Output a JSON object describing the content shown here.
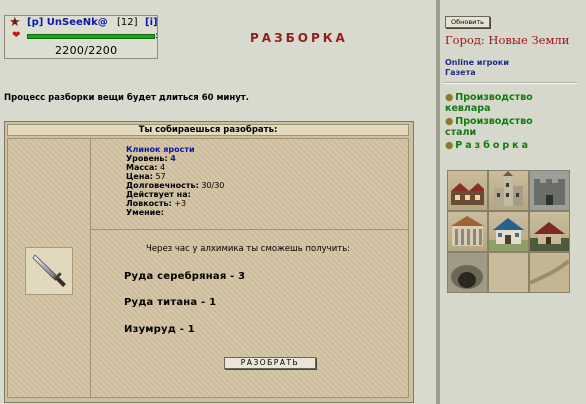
{
  "user": {
    "name": "[p] UnSeeNk@",
    "level": "[12]",
    "info_link": "[i]",
    "hp": "2200/2200",
    "hp_fraction": 1.0,
    "hp_colon": ":"
  },
  "page": {
    "title": "РАЗБОРКА",
    "notice": "Процесс разборки вещи будет длиться 60 минут."
  },
  "panel": {
    "header": "Ты собираешься разобрать:",
    "item": {
      "name": "Клинок ярости",
      "level_label": "Уровень:",
      "level_value": "4",
      "mass_label": "Масса:",
      "mass_value": "4",
      "price_label": "Цена:",
      "price_value": "57",
      "durability_label": "Долговечность:",
      "durability_value": "30/30",
      "acts_on_label": "Действует на:",
      "agility_label": "Ловкость:",
      "agility_value": "+3",
      "skill_label": "Умение:"
    },
    "reward_header": "Через час у алхимика ты сможешь получить:",
    "rewards": [
      "Руда серебряная - 3",
      "Руда титана - 1",
      "Изумруд - 1"
    ],
    "button_label": "РАЗОБРАТЬ"
  },
  "sidebar": {
    "refresh_label": "Обновить",
    "city": "Город: Новые Земли",
    "online_link": "Online игроки",
    "newspaper_link": "Газета",
    "nav": [
      {
        "line1": "Производство",
        "line2": "кевлара"
      },
      {
        "line1": "Производство",
        "line2": "стали"
      },
      {
        "line1": "Разборка",
        "line2": ""
      }
    ]
  },
  "colors": {
    "title": "#8f1e1e",
    "city": "#9a1515",
    "nav": "#117a11",
    "username": "#0d17a6"
  }
}
